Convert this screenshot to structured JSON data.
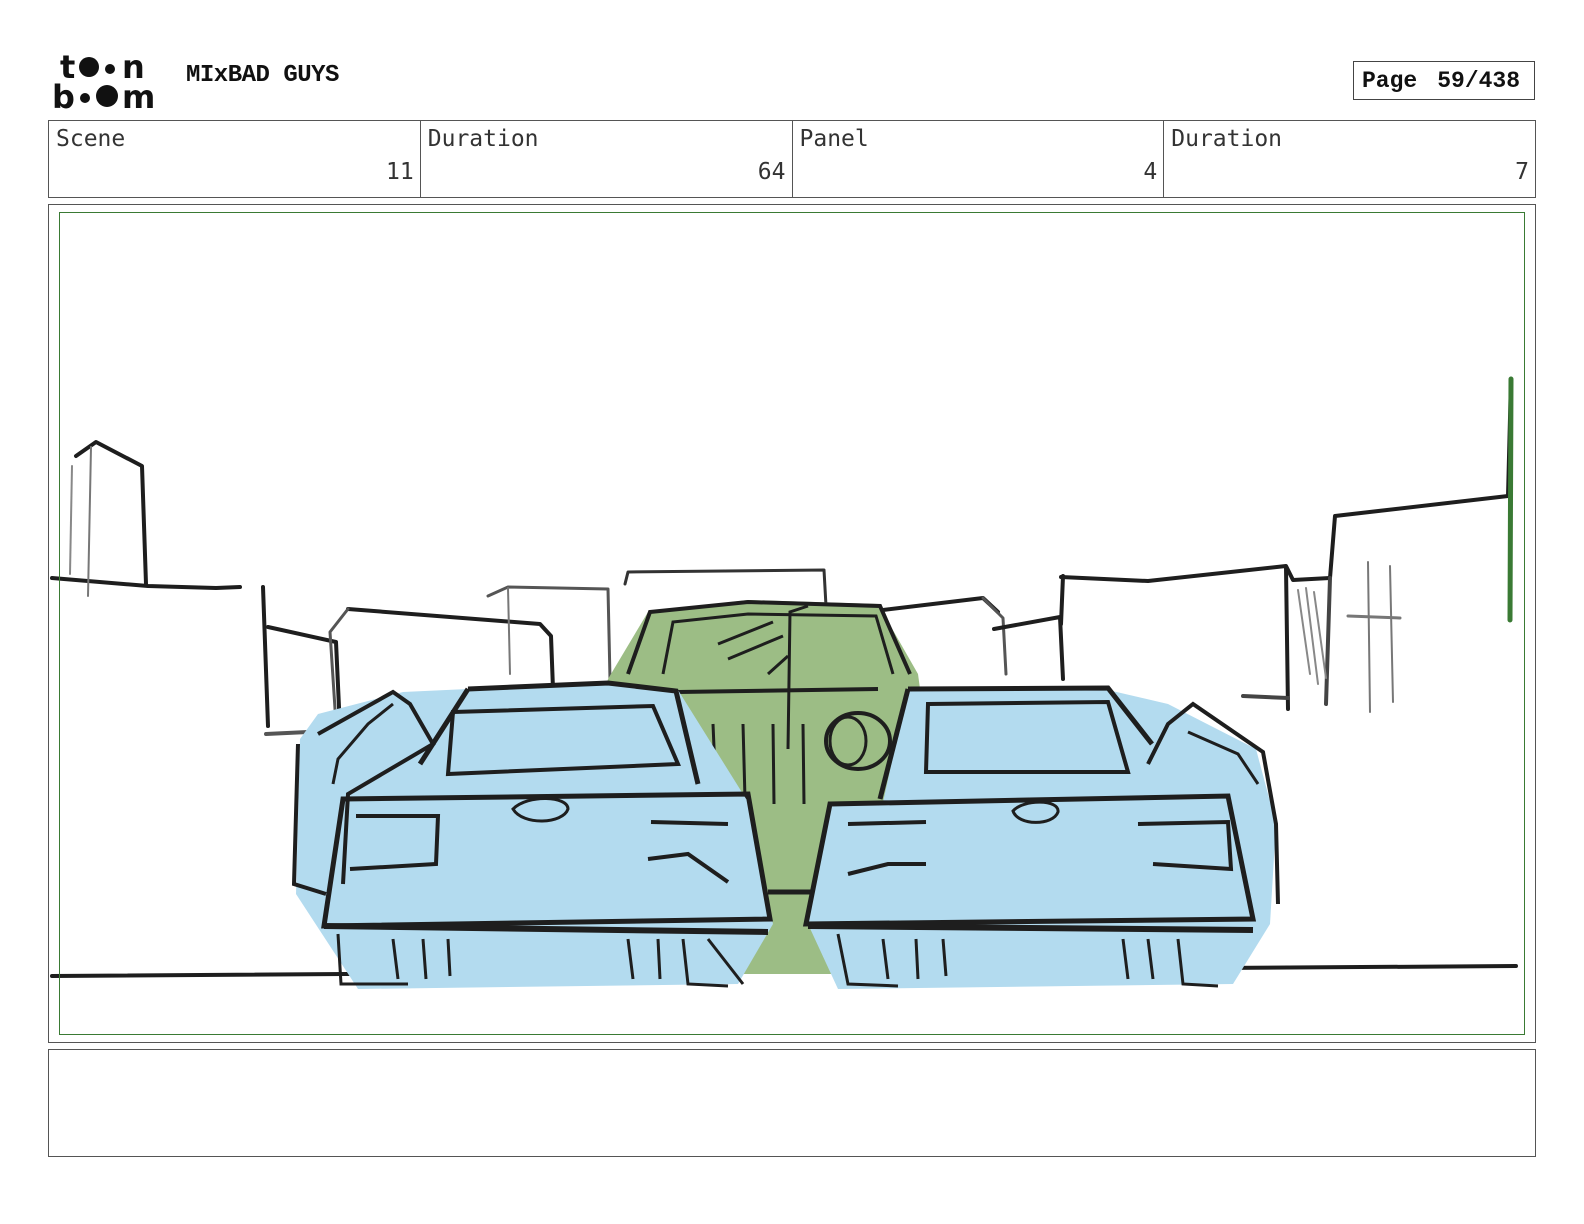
{
  "header": {
    "logo_text": "toon boom",
    "project_title": "MIxBAD GUYS",
    "page_label": "Page",
    "page_number": "59/438"
  },
  "info": {
    "scene_label": "Scene",
    "scene_value": "11",
    "scene_duration_label": "Duration",
    "scene_duration_value": "64",
    "panel_label": "Panel",
    "panel_value": "4",
    "panel_duration_label": "Duration",
    "panel_duration_value": "7"
  },
  "notes": "",
  "colors": {
    "blue_car": "#b3dbef",
    "green_car": "#9cbd85",
    "ink": "#1e1e1e",
    "safe_frame": "#3a7a34"
  }
}
